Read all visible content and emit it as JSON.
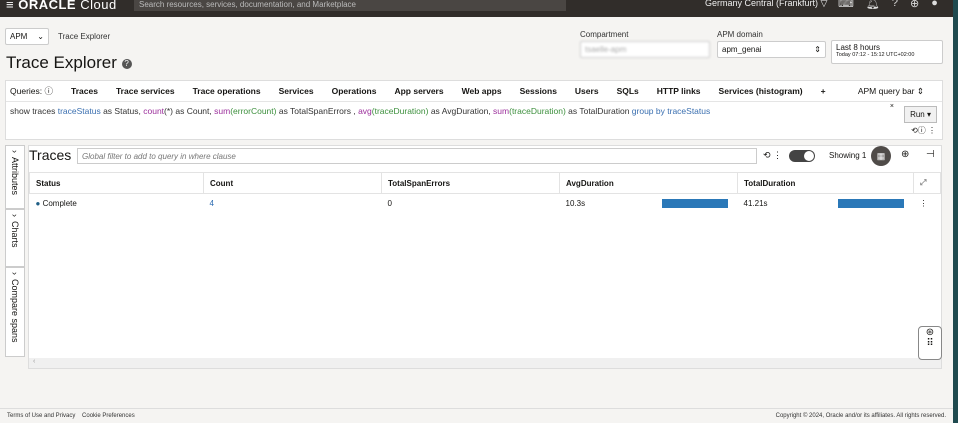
{
  "header": {
    "brand": "ORACLE",
    "brand_suffix": "Cloud",
    "search_placeholder": "Search resources, services, documentation, and Marketplace",
    "region": "Germany Central (Frankfurt)"
  },
  "breadcrumb": {
    "service": "APM",
    "page": "Trace Explorer"
  },
  "page_title": "Trace Explorer",
  "compartment": {
    "label": "Compartment",
    "value": "tsaelle-apm"
  },
  "apm_domain": {
    "label": "APM domain",
    "value": "apm_genai"
  },
  "time_range": {
    "value": "Last 8 hours",
    "detail": "Today 07:12 - 15:12 UTC+02:00"
  },
  "queries": {
    "label": "Queries:",
    "tabs": [
      "Traces",
      "Trace services",
      "Trace operations",
      "Services",
      "Operations",
      "App servers",
      "Web apps",
      "Sessions",
      "Users",
      "SQLs",
      "HTTP links",
      "Services (histogram)"
    ],
    "add": "+",
    "mode": "APM query bar"
  },
  "query": {
    "p1": "show traces ",
    "f1": "traceStatus",
    "p2": " as Status, ",
    "fn1": "count",
    "p3": "(*) as Count, ",
    "fn2": "sum",
    "f2": "(errorCount)",
    "p4": " as TotalSpanErrors , ",
    "fn3": "avg",
    "f3": "(traceDuration)",
    "p5": " as AvgDuration, ",
    "fn4": "sum",
    "f4": "(traceDuration)",
    "p6": " as TotalDuration ",
    "k1": "group by ",
    "f5": "traceStatus"
  },
  "run_label": "Run",
  "side_tabs": [
    "Attributes",
    "Charts",
    "Compare spans"
  ],
  "traces": {
    "title": "Traces",
    "filter_placeholder": "Global filter to add to query in where clause",
    "showing": "Showing 1"
  },
  "table": {
    "columns": [
      "Status",
      "Count",
      "TotalSpanErrors",
      "AvgDuration",
      "TotalDuration"
    ],
    "rows": [
      {
        "status": "Complete",
        "count": "4",
        "errors": "0",
        "avg": "10.3s",
        "total": "41.21s",
        "avg_fraction": 1.0,
        "total_fraction": 1.0
      }
    ]
  },
  "footer": {
    "terms": "Terms of Use and Privacy",
    "cookies": "Cookie Preferences",
    "copyright": "Copyright © 2024, Oracle and/or its affiliates. All rights reserved."
  }
}
